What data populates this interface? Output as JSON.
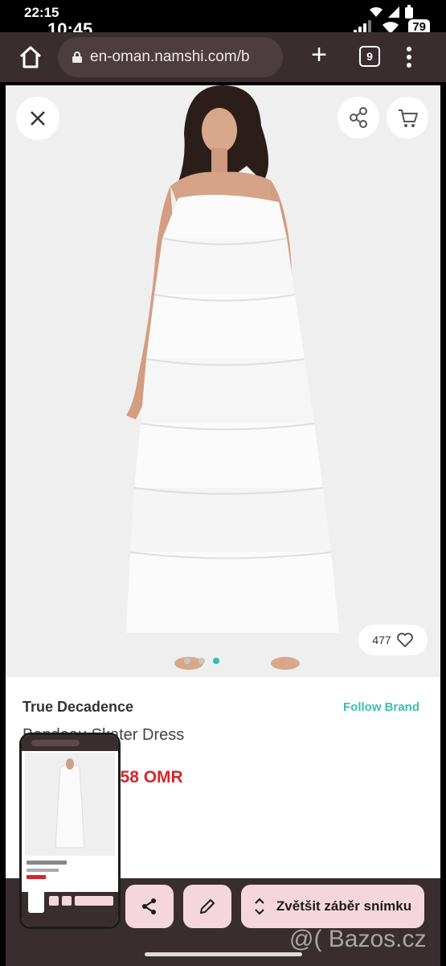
{
  "status": {
    "outer_time": "22:15",
    "inner_time": "10:45",
    "battery": "79"
  },
  "browser": {
    "url": "en-oman.namshi.com/b",
    "tab_count": "9"
  },
  "product": {
    "brand": "True Decadence",
    "follow_label": "Follow Brand",
    "name": "Bandeau Skater Dress",
    "price": "0.58 OMR",
    "likes": "477",
    "image_count": 3,
    "active_image": 3
  },
  "screenshot_tools": {
    "zoom_label": "Zvětšit záběr snímku"
  },
  "watermark": "@( Bazos.cz",
  "colors": {
    "accent_teal": "#2cc4b3",
    "price_red": "#d8262c",
    "browser_bar": "#3a2d30",
    "action_pink": "#f6d6dd"
  }
}
